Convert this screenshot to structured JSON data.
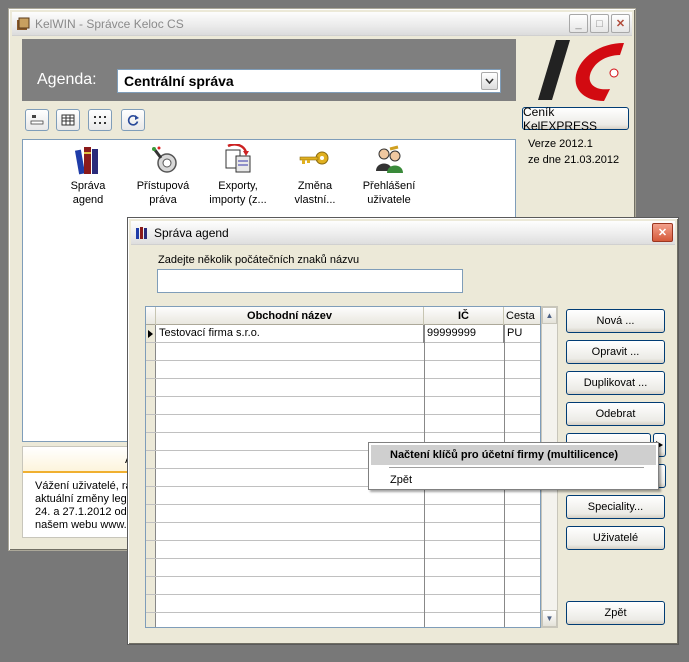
{
  "main_window": {
    "title": "KelWIN - Správce Keloc CS",
    "agenda_label": "Agenda:",
    "agenda_value": "Centrální správa",
    "cenik_button": "Ceník KelEXPRESS",
    "version": "Verze 2012.1",
    "date": "ze dne 21.03.2012",
    "icons": [
      {
        "line1": "Správa",
        "line2": "agend"
      },
      {
        "line1": "Přístupová",
        "line2": "práva"
      },
      {
        "line1": "Exporty,",
        "line2": "importy (z..."
      },
      {
        "line1": "Změna",
        "line2": "vlastní..."
      },
      {
        "line1": "Přehlášení",
        "line2": "uživatele"
      }
    ],
    "news_fragment": "A",
    "news_lines": [
      "Vážení uživatelé, rá",
      "aktuální změny legis",
      "24. a 27.1.2012 od",
      "našem webu www.k"
    ]
  },
  "dialog": {
    "title": "Správa agend",
    "search_label": "Zadejte několik počátečních znaků názvu",
    "search_value": "",
    "columns": [
      "Obchodní název",
      "IČ",
      "Cesta"
    ],
    "rows": [
      {
        "name": "Testovací firma s.r.o.",
        "ic": "99999999",
        "path": "PU"
      }
    ],
    "buttons": {
      "nova": "Nová ...",
      "opravit": "Opravit ...",
      "duplikovat": "Duplikovat ...",
      "odebrat": "Odebrat",
      "hidden": "Načtení klíčů",
      "speciality": "Speciality...",
      "uzivatele": "Uživatelé",
      "zpet": "Zpět"
    }
  },
  "context_menu": {
    "items": [
      "Načtení klíčů pro účetní firmy (multilicence)",
      "Zpět"
    ]
  },
  "colors": {
    "logo_red": "#d20a11",
    "desktop": "#787878",
    "panel": "#ece9d8"
  }
}
